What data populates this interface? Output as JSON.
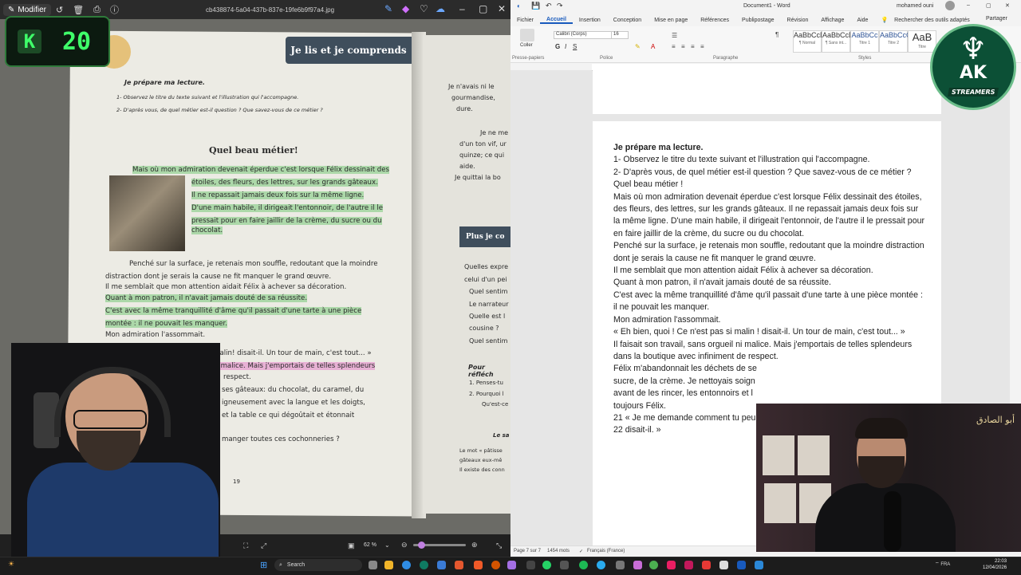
{
  "viewer": {
    "modifier_label": "Modifier",
    "filename": "cb438874-5a04-437b-837e-19fe6b9f97a4.jpg",
    "zoom": "62 %",
    "book": {
      "banner": "Je lis et je comprends",
      "prep_title": "Je prépare ma lecture.",
      "prep_q1": "1- Observez le titre du texte suivant et l'illustration qui l'accompagne.",
      "prep_q2": "2- D'après vous, de quel métier est-il question ? Que savez-vous de ce métier ?",
      "title": "Quel beau métier!",
      "lines": [
        "Mais où mon admiration devenait éperdue c'est lorsque Félix dessinait des",
        "étoiles, des fleurs, des lettres, sur les grands gâteaux.",
        "Il ne repassait jamais deux fois sur la même ligne.",
        "D'une main habile, il dirigeait l'entonnoir, de l'autre il le",
        "pressait pour en faire jaillir de la crème, du sucre ou du",
        "chocolat.",
        "Penché sur la surface, je retenais mon souffle, redoutant que la moindre",
        "distraction dont je serais la cause ne fit manquer le grand œuvre.",
        "Il me semblait que mon attention aidait Félix à achever sa décoration.",
        "Quant à mon patron, il n'avait jamais douté de sa réussite.",
        "C'est avec la même tranquillité d'âme qu'il passait d'une tarte à une pièce",
        "montée : il ne pouvait les manquer.",
        "Mon admiration l'assommait.",
        "i malin! disait-il. Un tour de main, c'est tout... »",
        "ni malice. Mais j'emportais de telles splendeurs",
        "respect.",
        "ses gâteaux: du chocolat, du caramel, du",
        "igneusement avec la langue et les doigts,",
        "et la table ce qui dégoûtait et étonnait",
        "manger toutes ces cochonneries ?"
      ],
      "page_number": "19",
      "right_page": {
        "lines_top": [
          "Je n'avais ni le",
          "gourmandise,",
          "dure.",
          "Je ne me",
          "d'un ton vif, ur",
          "quinze; ce qui",
          "aide.",
          "Je quittai la bo"
        ],
        "box_title": "Plus je co",
        "questions": [
          "Quelles expre",
          "celui d'un pei",
          "Quel sentim",
          "Le narrateur",
          "Quelle est l",
          "cousine ?",
          "Quel sentim"
        ],
        "reflect_title": "Pour réfléch",
        "reflect_lines": [
          "1. Penses-tu",
          "2. Pourquoi l",
          "Qu'est-ce"
        ],
        "note_title": "Le sa",
        "note_lines": [
          "Le mot « pâtisse",
          "gâteaux eux-mê",
          "Il existe des conn"
        ]
      }
    }
  },
  "score": {
    "letter": "K",
    "value": "20"
  },
  "word": {
    "title": "Document1 - Word",
    "user": "mohamed ouni",
    "tabs": [
      "Fichier",
      "Accueil",
      "Insertion",
      "Conception",
      "Mise en page",
      "Références",
      "Publipostage",
      "Révision",
      "Affichage",
      "Aide"
    ],
    "search_tools": "Rechercher des outils adaptés",
    "share": "Partager",
    "font_name": "Calibri (Corps)",
    "font_size": "16",
    "group_labels": {
      "clipboard": "Presse-papiers",
      "font": "Police",
      "paragraph": "Paragraphe",
      "styles": "Styles"
    },
    "paste_label": "Coller",
    "styles": [
      {
        "preview": "AaBbCcDd",
        "name": "¶ Normal"
      },
      {
        "preview": "AaBbCcDd",
        "name": "¶ Sans int..."
      },
      {
        "preview": "AaBbCc",
        "name": "Titre 1"
      },
      {
        "preview": "AaBbCcC",
        "name": "Titre 2"
      },
      {
        "preview": "AaB",
        "name": "Titre"
      }
    ],
    "doc_paragraphs": [
      "Je prépare ma lecture.",
      "1- Observez le titre du texte suivant et l'illustration qui l'accompagne.",
      "2- D'après vous, de quel métier est-il question ? Que savez-vous de ce métier ?",
      "",
      "",
      "Quel beau métier !",
      "",
      "Mais où mon admiration devenait éperdue c'est lorsque Félix dessinait des étoiles, des fleurs, des lettres, sur les grands gâteaux. Il ne repassait jamais deux fois sur la même ligne. D'une main habile, il dirigeait l'entonnoir, de l'autre il le pressait pour en faire jaillir de la crème, du sucre ou du chocolat.",
      "",
      "Penché sur la surface, je retenais mon souffle, redoutant que la moindre distraction dont je serais la cause ne fit manquer le grand œuvre.",
      "Il me semblait que mon attention aidait Félix à achever sa décoration.",
      "Quant à mon patron, il n'avait jamais douté de sa réussite.",
      "C'est avec la même tranquillité d'âme qu'il passait d'une tarte à une pièce montée : il ne pouvait les manquer.",
      "Mon admiration l'assommait.",
      "« Eh bien, quoi ! Ce n'est pas si malin ! disait-il. Un tour de main, c'est tout... »",
      "Il faisait son travail, sans orgueil ni malice. Mais j'emportais de telles splendeurs dans la boutique avec infiniment de respect.",
      "Félix m'abandonnait les déchets de se",
      "sucre, de la crème. Je nettoyais soign",
      "avant de les rincer, les entonnoirs et l",
      "toujours Félix.",
      "21 « Je me demande comment tu peu",
      "22 disait-il. »"
    ],
    "status": {
      "page": "Page 7 sur 7",
      "words": "1454 mots",
      "language": "Français (France)"
    }
  },
  "logo": {
    "text": "AK",
    "subtext": "STREAMERS"
  },
  "cam_right": {
    "name": "أبو الصادق"
  },
  "taskbar": {
    "search": "Search",
    "lang": "FRA",
    "time": "22:03",
    "date": "12/04/2026"
  },
  "colors": {
    "highlight_green": "#78c878",
    "word_blue": "#185abd",
    "badge_green": "#3fff6a"
  }
}
